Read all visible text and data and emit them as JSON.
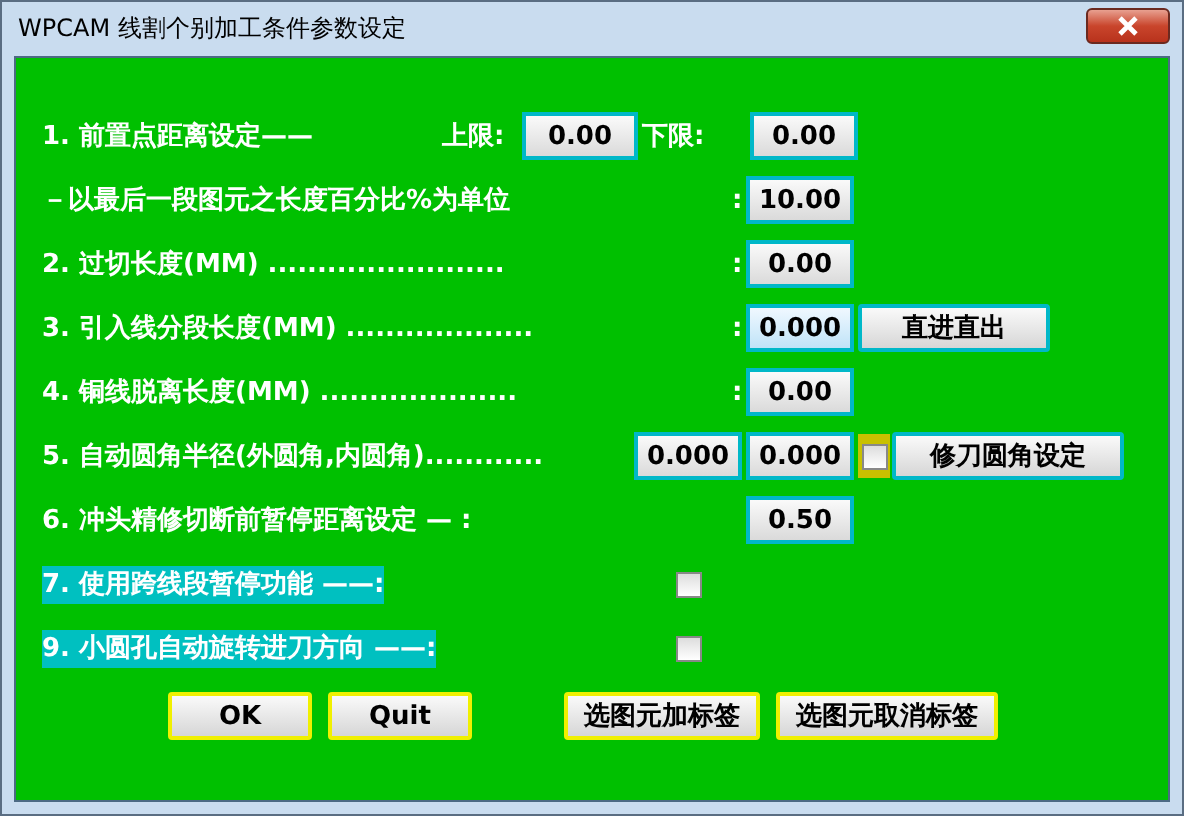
{
  "window": {
    "title": "WPCAM 线割个别加工条件参数设定"
  },
  "rows": [
    {
      "kind": "limits",
      "label": "1.  前置点距离设定——",
      "upper_label": "上限:",
      "upper": {
        "value": "0.00",
        "highlighted": false
      },
      "lower_label": "下限:",
      "lower": {
        "value": "0.00",
        "highlighted": false
      }
    },
    {
      "kind": "field",
      "label": "－以最后一段图元之长度百分比%为单位",
      "colon": ":",
      "fields": [
        {
          "value": "10.00",
          "highlighted": false
        }
      ]
    },
    {
      "kind": "field",
      "label": "2. 过切长度(MM)  ........................",
      "colon": ":",
      "fields": [
        {
          "value": "0.00",
          "highlighted": false
        }
      ]
    },
    {
      "kind": "field",
      "label": "3. 引入线分段长度(MM)  ...................",
      "colon": ":",
      "fields": [
        {
          "value": "0.000",
          "highlighted": true
        }
      ],
      "button": "直进直出"
    },
    {
      "kind": "field",
      "label": "4. 铜线脱离长度(MM)  ....................",
      "colon": ":",
      "fields": [
        {
          "value": "0.00",
          "highlighted": false
        }
      ]
    },
    {
      "kind": "field",
      "label": "5. 自动圆角半径(外圆角,内圆角)............",
      "fields": [
        {
          "value": "0.000",
          "highlighted": false
        },
        {
          "value": "0.000",
          "highlighted": false
        }
      ],
      "checkbox": {
        "checked": false,
        "focused": true
      },
      "button": "修刀圆角设定"
    },
    {
      "kind": "field",
      "label": "6. 冲头精修切断前暂停距离设定 —  :",
      "fields": [
        {
          "value": "0.50",
          "highlighted": false
        }
      ]
    },
    {
      "kind": "check",
      "label": "7. 使用跨线段暂停功能     ——:",
      "checked": false
    },
    {
      "kind": "check",
      "label": "9. 小圆孔自动旋转进刀方向 ——:",
      "checked": false
    }
  ],
  "buttons": [
    {
      "label": "OK"
    },
    {
      "label": "Quit"
    },
    {
      "label": "选图元加标签"
    },
    {
      "label": "选图元取消标签"
    }
  ]
}
